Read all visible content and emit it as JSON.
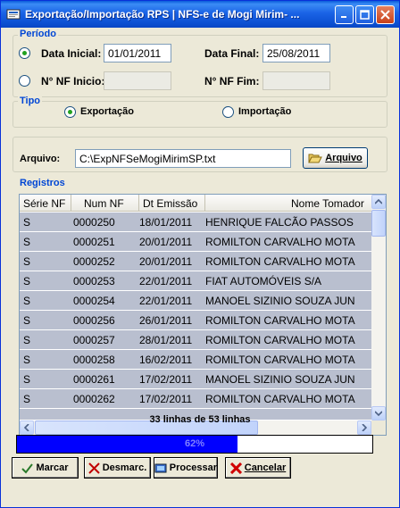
{
  "window": {
    "title": "Exportação/Importação RPS  |  NFS-e de Mogi Mirim- ..."
  },
  "periodo": {
    "group_label": "Período",
    "data_inicial_label": "Data Inicial:",
    "data_inicial_value": "01/01/2011",
    "data_final_label": "Data Final:",
    "data_final_value": "25/08/2011",
    "nf_inicio_label": "N° NF Inicio:",
    "nf_inicio_value": "",
    "nf_fim_label": "N° NF Fim:",
    "nf_fim_value": "",
    "selected": "data"
  },
  "tipo": {
    "group_label": "Tipo",
    "exportacao_label": "Exportação",
    "importacao_label": "Importação",
    "selected": "exportacao"
  },
  "arquivo": {
    "label": "Arquivo:",
    "value": "C:\\ExpNFSeMogiMirimSP.txt",
    "button_label": "Arquivo"
  },
  "registros": {
    "group_label": "Registros",
    "columns": [
      "Série NF",
      "Num NF",
      "Dt Emissão",
      "Nome Tomador"
    ],
    "rows": [
      [
        "S",
        "0000250",
        "18/01/2011",
        "HENRIQUE FALCÃO PASSOS"
      ],
      [
        "S",
        "0000251",
        "20/01/2011",
        "ROMILTON CARVALHO MOTA"
      ],
      [
        "S",
        "0000252",
        "20/01/2011",
        "ROMILTON CARVALHO MOTA"
      ],
      [
        "S",
        "0000253",
        "22/01/2011",
        "FIAT AUTOMÓVEIS S/A"
      ],
      [
        "S",
        "0000254",
        "22/01/2011",
        "MANOEL SIZINIO SOUZA JUN"
      ],
      [
        "S",
        "0000256",
        "26/01/2011",
        "ROMILTON CARVALHO MOTA"
      ],
      [
        "S",
        "0000257",
        "28/01/2011",
        "ROMILTON CARVALHO MOTA"
      ],
      [
        "S",
        "0000258",
        "16/02/2011",
        "ROMILTON CARVALHO MOTA"
      ],
      [
        "S",
        "0000261",
        "17/02/2011",
        "MANOEL SIZINIO SOUZA JUN"
      ],
      [
        "S",
        "0000262",
        "17/02/2011",
        "ROMILTON CARVALHO MOTA"
      ]
    ],
    "count_text": "33 linhas de 53 linhas"
  },
  "progress": {
    "percent": 62,
    "label": "62%"
  },
  "buttons": {
    "marcar": "Marcar",
    "desmarcar": "Desmarc.",
    "processar": "Processar",
    "cancelar": "Cancelar"
  },
  "colors": {
    "accent": "#0046d5",
    "progress_fill": "#0000ff",
    "row_background": "#b9bfcf"
  }
}
